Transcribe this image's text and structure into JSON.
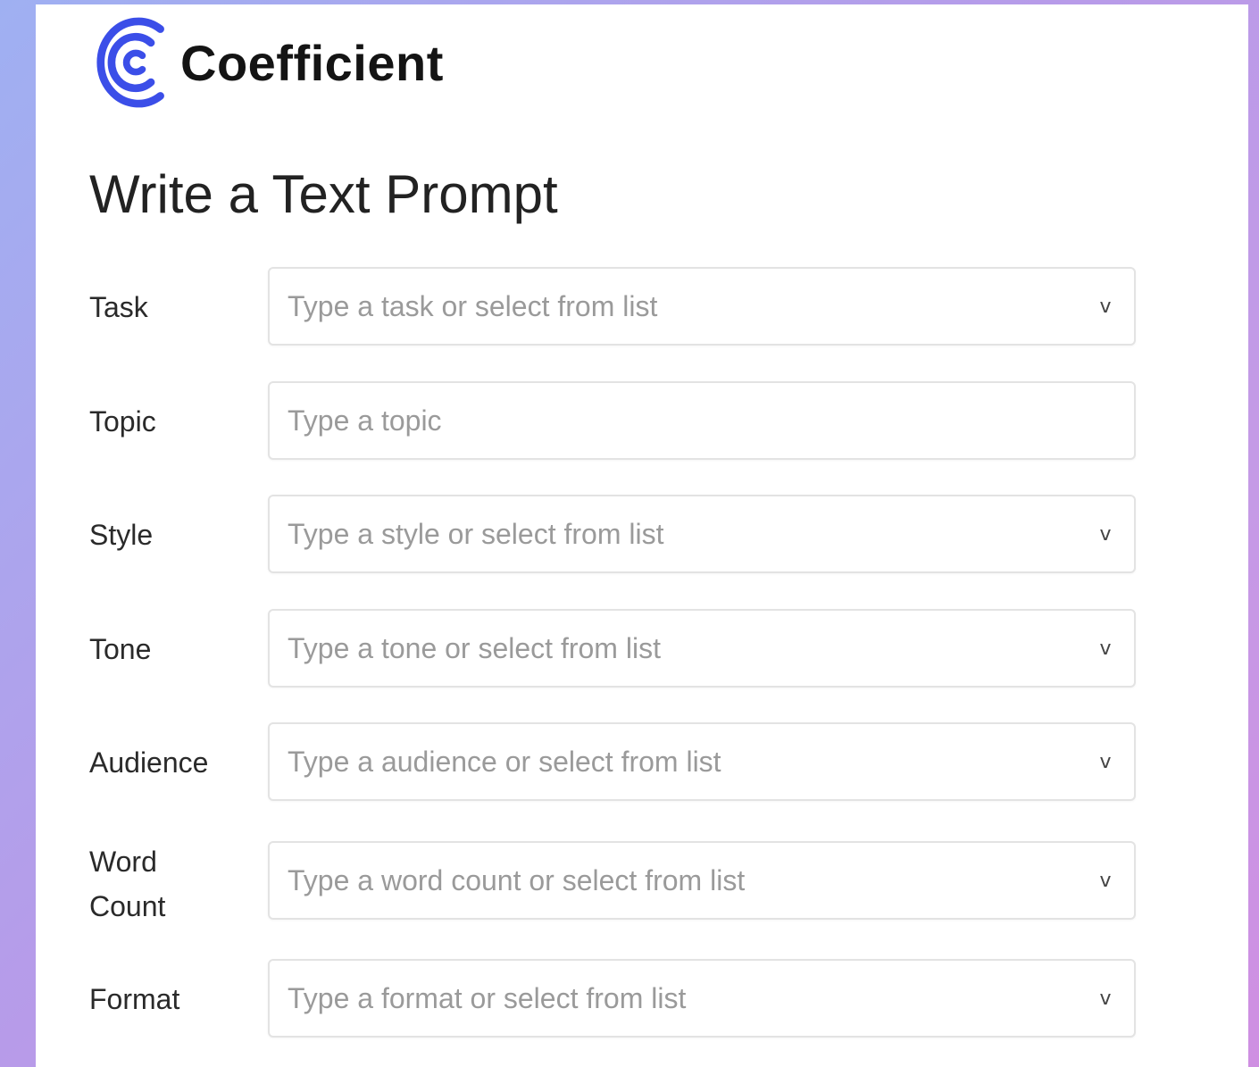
{
  "brand": {
    "name": "Coefficient",
    "logo_color": "#3b4ee8"
  },
  "page": {
    "title": "Write a Text Prompt"
  },
  "fields": [
    {
      "label": "Task",
      "placeholder": "Type a task or select from list",
      "value": "",
      "has_dropdown": true,
      "icon": "chevron-down-icon",
      "chevron": "v"
    },
    {
      "label": "Topic",
      "placeholder": "Type a topic",
      "value": "",
      "has_dropdown": false
    },
    {
      "label": "Style",
      "placeholder": "Type a style or select from list",
      "value": "",
      "has_dropdown": true,
      "icon": "chevron-down-icon",
      "chevron": "v"
    },
    {
      "label": "Tone",
      "placeholder": "Type a tone or select from list",
      "value": "",
      "has_dropdown": true,
      "icon": "chevron-down-icon",
      "chevron": "v"
    },
    {
      "label": "Audience",
      "placeholder": "Type a audience or select from list",
      "value": "",
      "has_dropdown": true,
      "icon": "chevron-down-icon",
      "chevron": "v"
    },
    {
      "label": "Word Count",
      "placeholder": "Type a word count or select from list",
      "value": "",
      "has_dropdown": true,
      "icon": "chevron-down-icon",
      "chevron": "v"
    },
    {
      "label": "Format",
      "placeholder": "Type a format or select from list",
      "value": "",
      "has_dropdown": true,
      "icon": "chevron-down-icon",
      "chevron": "v"
    }
  ],
  "colors": {
    "background_gradient_start": "#9fb0f2",
    "background_gradient_end": "#cf8fe2",
    "panel": "#ffffff",
    "field_border": "#e3e3e3",
    "placeholder": "#9a9a9a"
  }
}
